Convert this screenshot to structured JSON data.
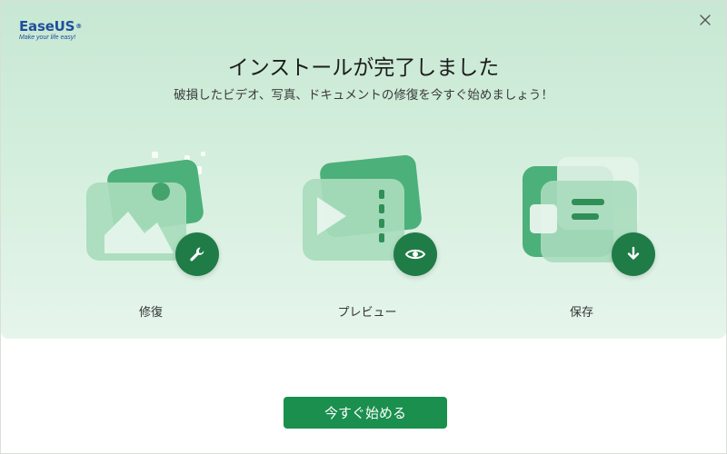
{
  "app": {
    "logo": {
      "name": "EaseUS",
      "reg_mark": "®",
      "tagline": "Make your life easy!"
    }
  },
  "header": {
    "title": "インストールが完了しました",
    "subtitle": "破損したビデオ、写真、ドキュメントの修復を今すぐ始めましょう！"
  },
  "features": [
    {
      "label": "修復",
      "icon": "wrench-icon"
    },
    {
      "label": "プレビュー",
      "icon": "eye-icon"
    },
    {
      "label": "保存",
      "icon": "download-icon"
    }
  ],
  "actions": {
    "start_label": "今すぐ始める"
  },
  "colors": {
    "accent": "#1a8f4e",
    "badge": "#1f7c47",
    "logo": "#1f4e9c",
    "background_top": "#c7e8d3"
  }
}
